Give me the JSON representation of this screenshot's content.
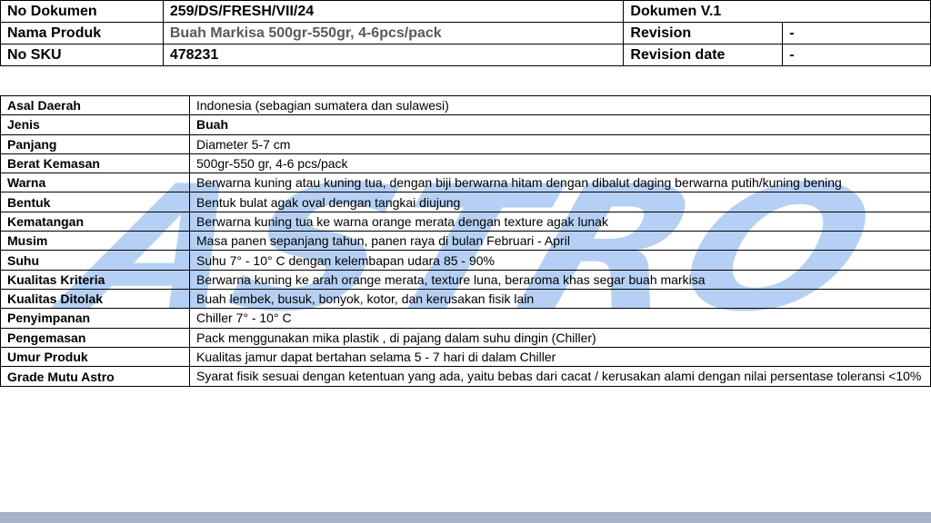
{
  "header": {
    "no_dokumen_label": "No Dokumen",
    "no_dokumen_value": "259/DS/FRESH/VII/24",
    "dokumen_version": "Dokumen V.1",
    "nama_produk_label": "Nama Produk",
    "nama_produk_value": "Buah Markisa 500gr-550gr, 4-6pcs/pack",
    "revision_label": "Revision",
    "revision_value": "-",
    "no_sku_label": "No SKU",
    "no_sku_value": "478231",
    "revision_date_label": "Revision date",
    "revision_date_value": "-"
  },
  "specs": [
    {
      "label": "Asal Daerah",
      "value": "Indonesia (sebagian sumatera  dan sulawesi)"
    },
    {
      "label": "Jenis",
      "value": "Buah"
    },
    {
      "label": "Panjang",
      "value": "Diameter 5-7 cm"
    },
    {
      "label": "Berat Kemasan",
      "value": "500gr-550 gr, 4-6 pcs/pack"
    },
    {
      "label": "Warna",
      "value": "Berwarna kuning atau kuning tua, dengan biji berwarna hitam dengan dibalut daging berwarna putih/kuning bening"
    },
    {
      "label": "Bentuk",
      "value": "Bentuk bulat agak oval dengan tangkai diujung"
    },
    {
      "label": "Kematangan",
      "value": "Berwarna kuning tua ke warna orange merata dengan texture agak lunak"
    },
    {
      "label": "Musim",
      "value": "Masa panen sepanjang tahun, panen raya di bulan Februari - April"
    },
    {
      "label": "Suhu",
      "value": "Suhu 7° - 10° C dengan kelembapan udara 85 - 90%"
    },
    {
      "label": "Kualitas Kriteria",
      "value": "Berwarna kuning ke arah orange merata, texture luna, beraroma khas segar buah markisa"
    },
    {
      "label": "Kualitas Ditolak",
      "value": "Buah lembek, busuk, bonyok, kotor, dan kerusakan fisik lain"
    },
    {
      "label": "Penyimpanan",
      "value": "Chiller 7° - 10° C"
    },
    {
      "label": "Pengemasan",
      "value": "Pack menggunakan mika plastik , di pajang dalam suhu dingin (Chiller)"
    },
    {
      "label": "Umur Produk",
      "value": "Kualitas jamur dapat bertahan selama 5 - 7 hari di dalam Chiller"
    },
    {
      "label": "Grade Mutu Astro",
      "value": "Syarat fisik sesuai dengan ketentuan yang ada, yaitu bebas dari cacat / kerusakan alami dengan  nilai persentase toleransi <10%"
    }
  ],
  "watermark": {
    "text": "ASTRO",
    "color": "#2f7be0"
  },
  "colors": {
    "footer_bar": "#a6b2c8",
    "grey_text": "#595959"
  }
}
